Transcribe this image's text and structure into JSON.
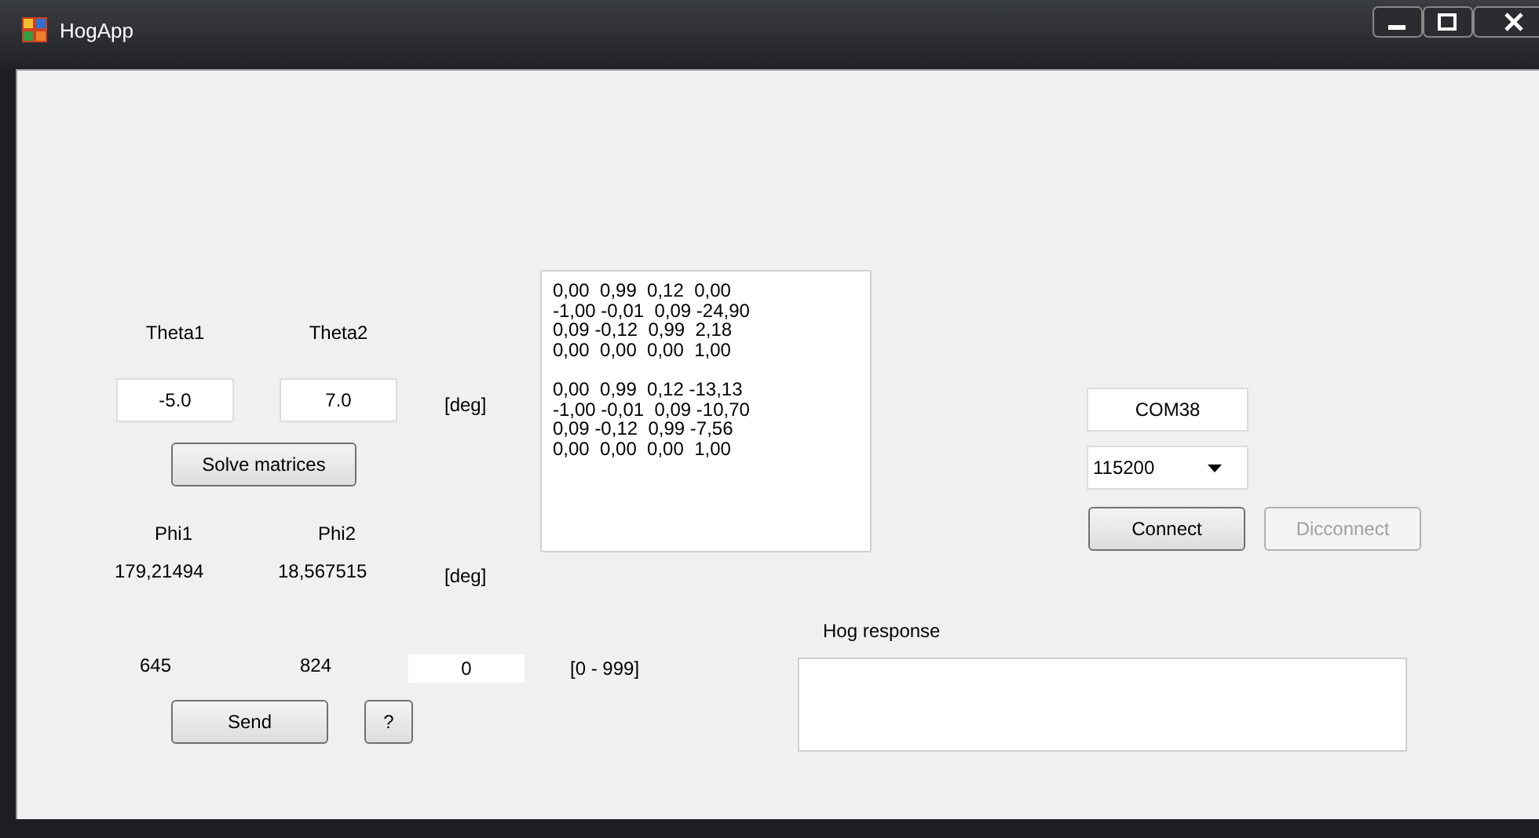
{
  "window": {
    "title": "HogApp"
  },
  "theta": {
    "labels": [
      "Theta1",
      "Theta2"
    ],
    "values": [
      "-5.0",
      "7.0"
    ],
    "unit": "[deg]"
  },
  "solve_button": {
    "label": "Solve matrices",
    "disabled": false
  },
  "phi": {
    "labels": [
      "Phi1",
      "Phi2"
    ],
    "values": [
      "179,21494",
      "18,567515"
    ],
    "unit": "[deg]"
  },
  "matrices": [
    [
      "0,00  0,99  0,12  0,00",
      "-1,00 -0,01  0,09 -24,90",
      "0,09 -0,12  0,99  2,18",
      "0,00  0,00  0,00  1,00"
    ],
    [
      "0,00  0,99  0,12 -13,13",
      "-1,00 -0,01  0,09 -10,70",
      "0,09 -0,12  0,99 -7,56",
      "0,00  0,00  0,00  1,00"
    ]
  ],
  "send_row": {
    "values": [
      "645",
      "824"
    ],
    "input": "0",
    "range": "[0 - 999]"
  },
  "send_button": {
    "label": "Send",
    "disabled": false
  },
  "help_button": {
    "label": "?",
    "disabled": false
  },
  "port": {
    "value": "COM38"
  },
  "baud": {
    "value": "115200"
  },
  "connect_buttons": [
    {
      "label": "Connect",
      "disabled": false
    },
    {
      "label": "Dicconnect",
      "disabled": true
    }
  ],
  "response": {
    "label": "Hog response"
  }
}
